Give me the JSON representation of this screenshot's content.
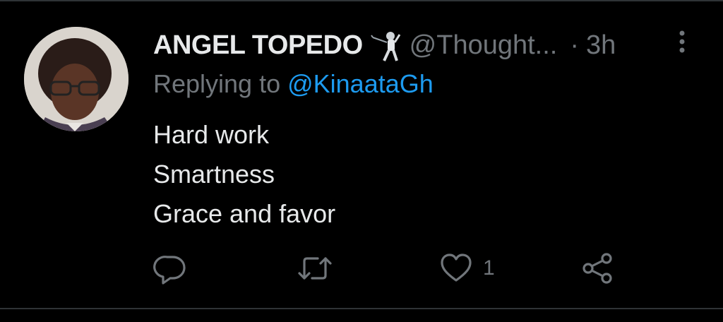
{
  "tweet": {
    "display_name": "ANGEL TOPEDO",
    "emoji_name": "person-fencing-icon",
    "handle": "@Thought...",
    "separator": "·",
    "time": "3h",
    "reply": {
      "prefix": "Replying to ",
      "mention": "@KinaataGh"
    },
    "lines": [
      "Hard work",
      "Smartness",
      "Grace and favor"
    ],
    "actions": {
      "reply_icon": "reply-icon",
      "retweet_icon": "retweet-icon",
      "like_icon": "heart-icon",
      "like_count": "1",
      "share_icon": "share-icon"
    },
    "more_icon": "more-vertical-icon"
  },
  "colors": {
    "background": "#000000",
    "primary_text": "#e7e9ea",
    "secondary_text": "#71767b",
    "link": "#1d9bf0",
    "divider": "#2f3336"
  }
}
